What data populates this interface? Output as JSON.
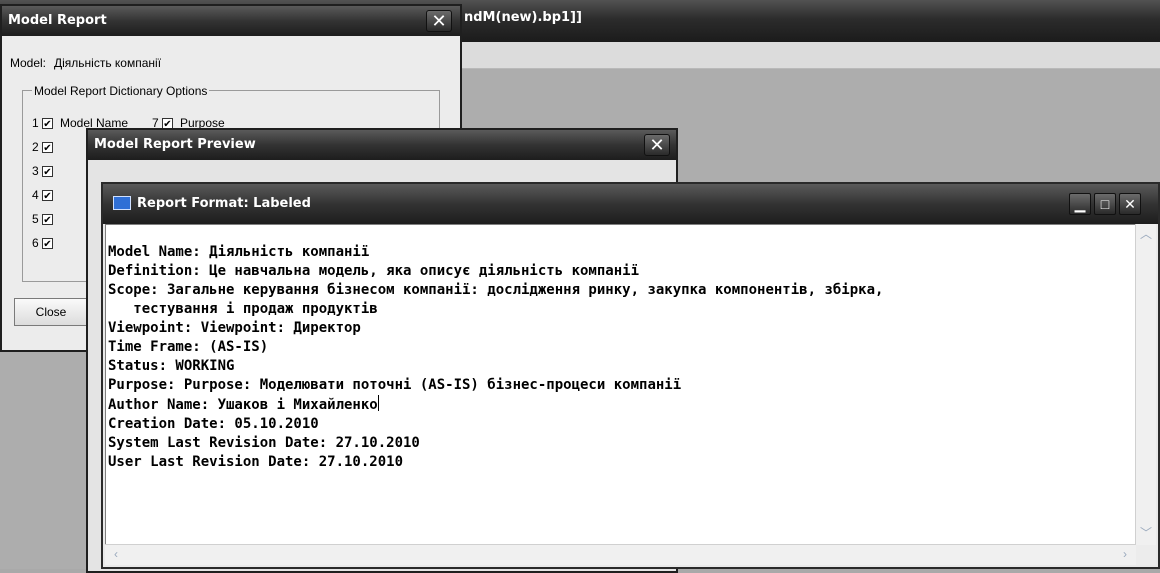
{
  "app": {
    "title_fragment": "ndM(new).bp1]]"
  },
  "model_report": {
    "title": "Model Report",
    "close_glyph": "✕",
    "model_label": "Model:",
    "model_value": "Діяльність компанії",
    "group_title": "Model Report Dictionary Options",
    "rows": [
      {
        "num": "1",
        "label": "Model Name",
        "num2": "7",
        "label2": "Purpose"
      },
      {
        "num": "2"
      },
      {
        "num": "3"
      },
      {
        "num": "4"
      },
      {
        "num": "5"
      },
      {
        "num": "6"
      }
    ],
    "check_glyph": "✔",
    "close_button": "Close"
  },
  "preview": {
    "title": "Model Report Preview",
    "close_glyph": "✕"
  },
  "report": {
    "title": "Report Format: Labeled",
    "minimize_glyph": "▁",
    "maximize_glyph": "□",
    "close_glyph": "✕",
    "lines": [
      "Model Name: Діяльність компанії",
      "Definition: Це навчальна модель, яка описує діяльність компанії",
      "Scope: Загальне керування бізнесом компанії: дослідження ринку, закупка компонентів, збірка,",
      "   тестування і продаж продуктів",
      "Viewpoint: Viewpoint: Директор",
      "Time Frame: (AS-IS)",
      "Status: WORKING",
      "Purpose: Purpose: Моделювати поточні (AS-IS) бізнес-процеси компанії",
      "Author Name: Ушаков і Михайленко",
      "Creation Date: 05.10.2010",
      "System Last Revision Date: 27.10.2010",
      "User Last Revision Date: 27.10.2010"
    ]
  }
}
